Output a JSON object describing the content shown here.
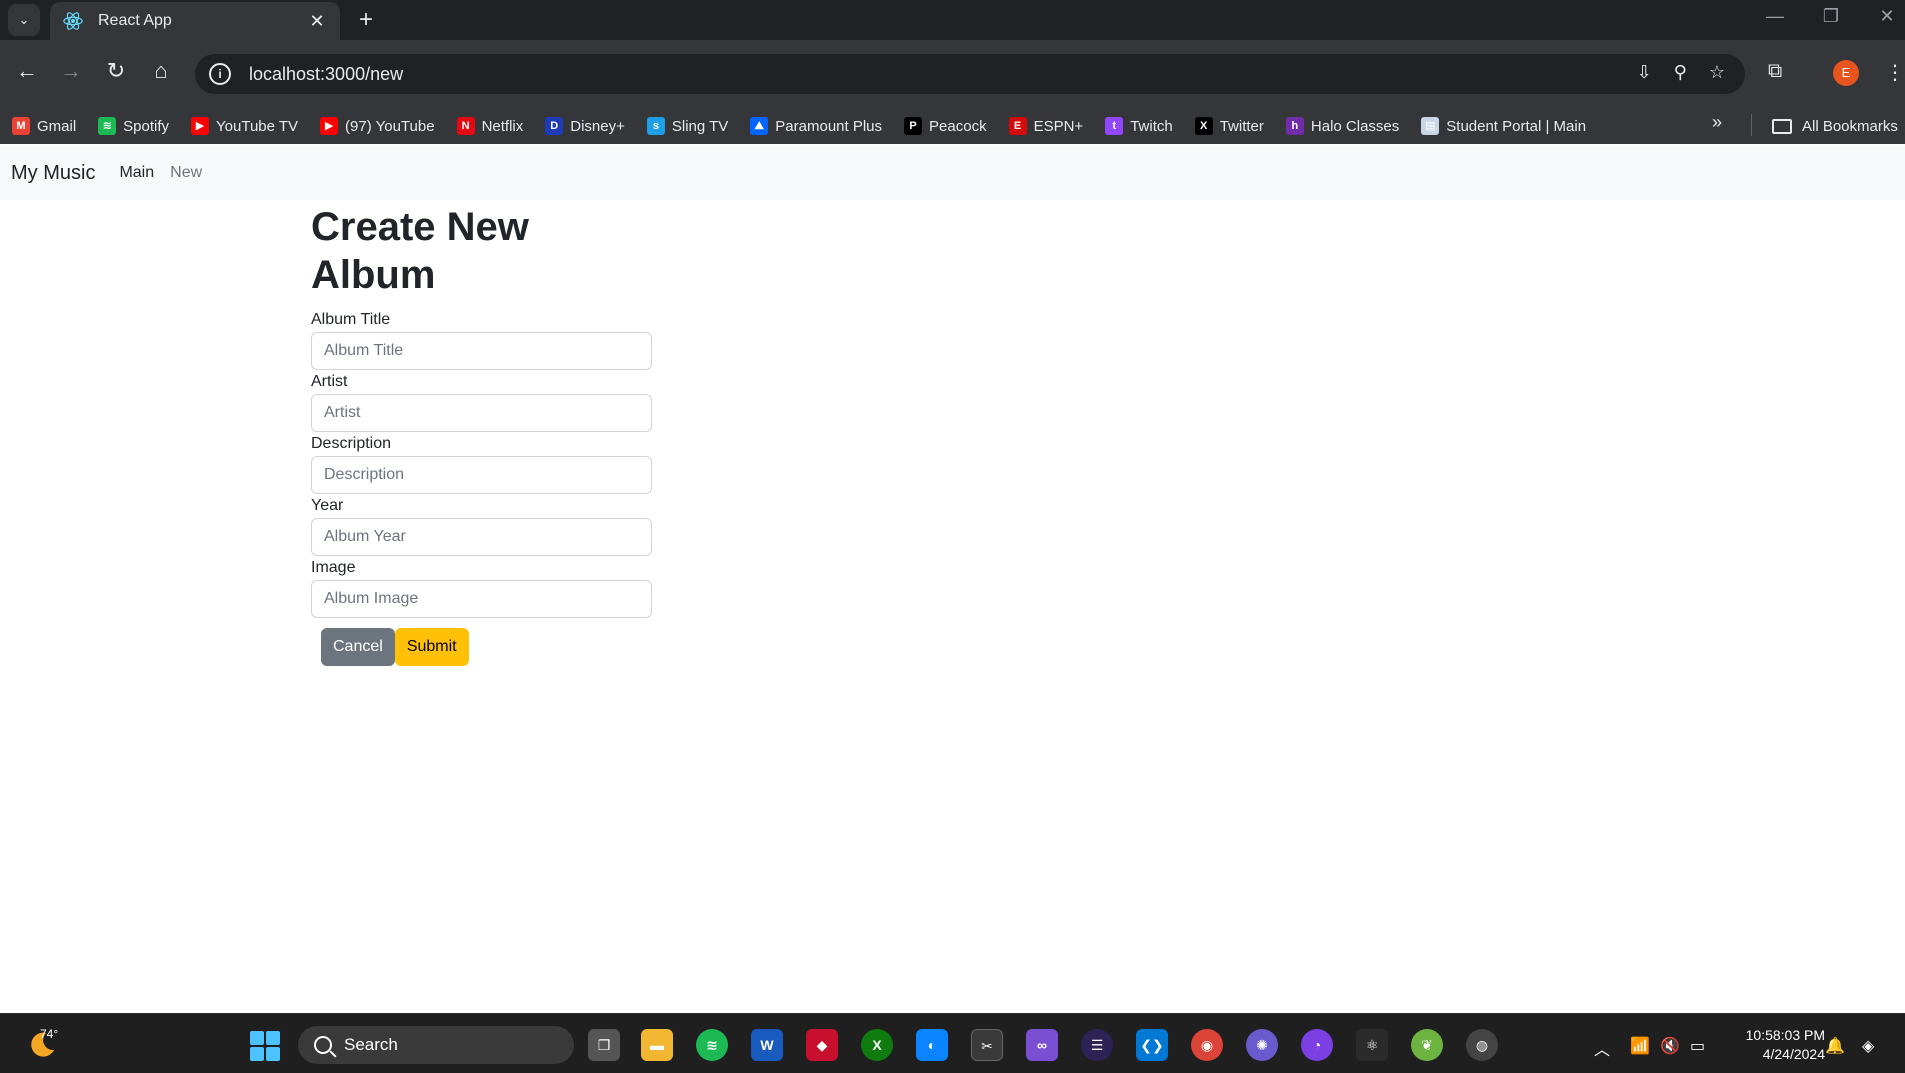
{
  "browser": {
    "tab_title": "React App",
    "url": "localhost:3000/new",
    "profile_initial": "E",
    "bookmarks": [
      {
        "label": "Gmail",
        "color": "#ea4335",
        "glyph": "M"
      },
      {
        "label": "Spotify",
        "color": "#1db954",
        "glyph": "≋"
      },
      {
        "label": "YouTube TV",
        "color": "#ff0000",
        "glyph": "▶"
      },
      {
        "label": "(97) YouTube",
        "color": "#ff0000",
        "glyph": "▶"
      },
      {
        "label": "Netflix",
        "color": "#e50914",
        "glyph": "N"
      },
      {
        "label": "Disney+",
        "color": "#1f3cb8",
        "glyph": "D"
      },
      {
        "label": "Sling TV",
        "color": "#1ea0e8",
        "glyph": "s"
      },
      {
        "label": "Paramount Plus",
        "color": "#0064ff",
        "glyph": "⛰"
      },
      {
        "label": "Peacock",
        "color": "#000000",
        "glyph": "P"
      },
      {
        "label": "ESPN+",
        "color": "#d50a0a",
        "glyph": "E"
      },
      {
        "label": "Twitch",
        "color": "#9146ff",
        "glyph": "t"
      },
      {
        "label": "Twitter",
        "color": "#000000",
        "glyph": "X"
      },
      {
        "label": "Halo Classes",
        "color": "#6f2da8",
        "glyph": "h"
      },
      {
        "label": "Student Portal | Main",
        "color": "#c9d6e8",
        "glyph": "▤"
      }
    ],
    "all_bookmarks_label": "All Bookmarks"
  },
  "navbar": {
    "brand": "My Music",
    "links": [
      {
        "label": "Main"
      },
      {
        "label": "New"
      }
    ]
  },
  "form": {
    "heading": "Create New Album",
    "fields": [
      {
        "label": "Album Title",
        "placeholder": "Album Title",
        "value": ""
      },
      {
        "label": "Artist",
        "placeholder": "Artist",
        "value": ""
      },
      {
        "label": "Description",
        "placeholder": "Description",
        "value": ""
      },
      {
        "label": "Year",
        "placeholder": "Album Year",
        "value": ""
      },
      {
        "label": "Image",
        "placeholder": "Album Image",
        "value": ""
      }
    ],
    "cancel_label": "Cancel",
    "submit_label": "Submit"
  },
  "taskbar": {
    "weather_temp": "74°",
    "search_label": "Search",
    "time": "10:58:03 PM",
    "date": "4/24/2024"
  },
  "colors": {
    "accent_submit": "#ffc107",
    "secondary_cancel": "#6c757d",
    "navbar_bg": "#f8f9fa"
  }
}
